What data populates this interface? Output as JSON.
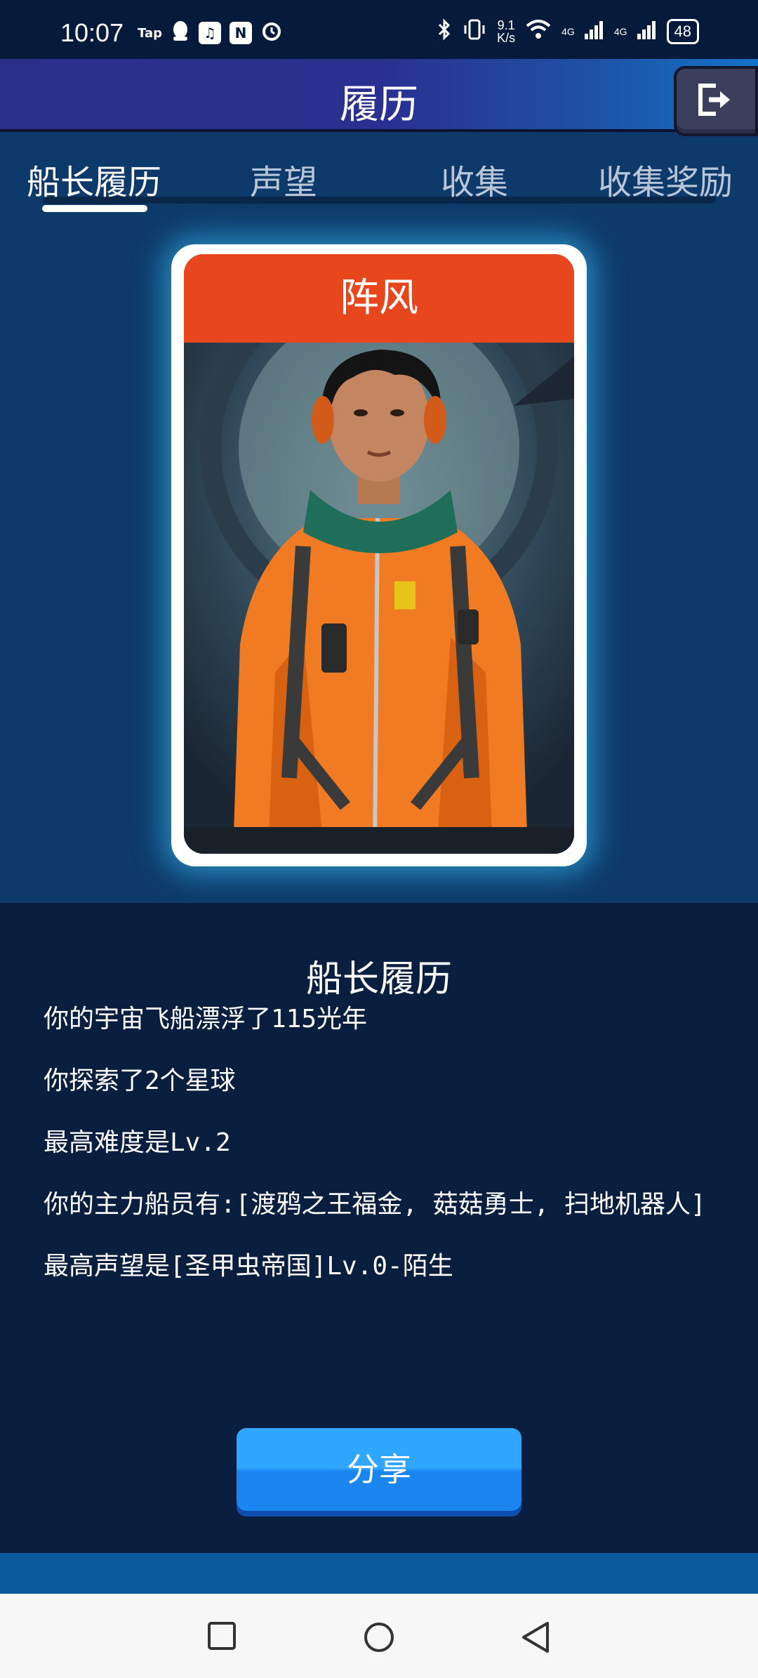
{
  "status_bar": {
    "time": "10:07",
    "tap_label": "Tap",
    "net_speed_value": "9.1",
    "net_speed_unit": "K/s",
    "signal_label_1": "4G",
    "signal_label_2": "4G",
    "battery": "48"
  },
  "header": {
    "title": "履历",
    "exit_icon": "exit-icon"
  },
  "tabs": [
    {
      "label": "船长履历",
      "active": true
    },
    {
      "label": "声望",
      "active": false
    },
    {
      "label": "收集",
      "active": false
    },
    {
      "label": "收集奖励",
      "active": false
    }
  ],
  "card": {
    "title": "阵风",
    "title_color": "#e8461c"
  },
  "resume": {
    "title": "船长履历",
    "lines": [
      "你的宇宙飞船漂浮了115光年",
      "你探索了2个星球",
      "最高难度是Lv.2",
      "你的主力船员有:[渡鸦之王福金, 菇菇勇士, 扫地机器人]",
      "最高声望是[圣甲虫帝国]Lv.0-陌生"
    ]
  },
  "share_button": {
    "label": "分享"
  },
  "nav_bar": {
    "icons": [
      "recent-apps-icon",
      "home-icon",
      "back-icon"
    ]
  }
}
